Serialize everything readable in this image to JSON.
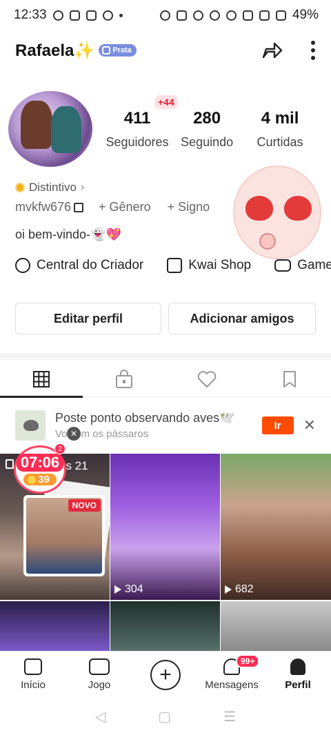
{
  "status_bar": {
    "time": "12:33",
    "battery": "49%"
  },
  "header": {
    "username": "Rafaela✨",
    "badge": "Prata"
  },
  "stats": {
    "new_followers": "+44",
    "followers": {
      "value": "411",
      "label": "Seguidores"
    },
    "following": {
      "value": "280",
      "label": "Seguindo"
    },
    "likes": {
      "value": "4 mil",
      "label": "Curtidas"
    }
  },
  "profile": {
    "badge_label": "Distintivo",
    "user_id": "mvkfw676",
    "gender": "+ Gênero",
    "sign": "+ Signo",
    "bio": "oi bem-vindo-👻💖"
  },
  "links": [
    {
      "label": "Central do Criador",
      "icon": "lightning-pin-icon"
    },
    {
      "label": "Kwai Shop",
      "icon": "shopping-bag-icon"
    },
    {
      "label": "Game",
      "icon": "gamepad-icon"
    }
  ],
  "buttons": {
    "edit": "Editar perfil",
    "add_friends": "Adicionar amigos"
  },
  "tabs": [
    "grid-icon",
    "lock-bag-icon",
    "heart-icon",
    "bookmark-icon"
  ],
  "promo": {
    "title": "Poste ponto observando aves🕊️",
    "subtitle": "Vo  com os pássaros",
    "cta": "Ir"
  },
  "timer": {
    "time": "07:06",
    "coins": "39",
    "badge": "2"
  },
  "videos": [
    {
      "days_text": "as 21",
      "tag": "NOVO"
    },
    {
      "views": "304"
    },
    {
      "views": "682"
    }
  ],
  "bottom_nav": {
    "home": "Início",
    "game": "Jogo",
    "messages": "Mensagens",
    "messages_badge": "99+",
    "profile": "Perfil"
  },
  "colors": {
    "accent": "#ff4b00",
    "badge": "#ff2d55",
    "prata": "#7a8ee0"
  }
}
